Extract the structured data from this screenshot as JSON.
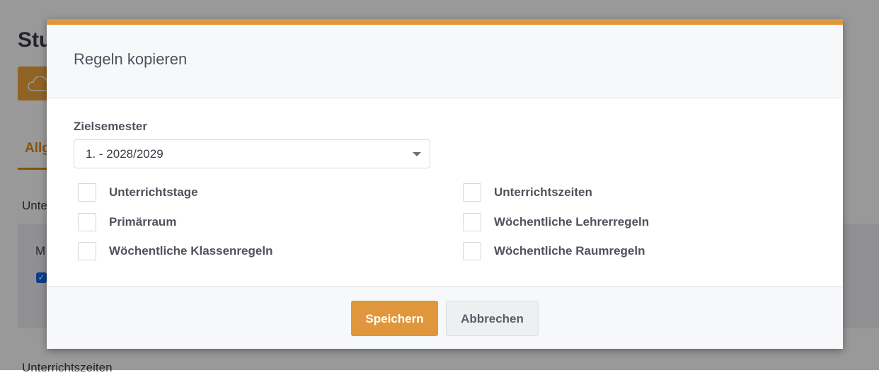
{
  "background": {
    "title": "Stu",
    "tab_label": "Allg",
    "section1": "Unte",
    "panel_label": "M",
    "section2": "Unterrichtszeiten"
  },
  "modal": {
    "title": "Regeln kopieren",
    "target_semester": {
      "label": "Zielsemester",
      "selected": "1. - 2028/2029"
    },
    "options": [
      {
        "label": "Unterrichtstage",
        "checked": false
      },
      {
        "label": "Unterrichtszeiten",
        "checked": false
      },
      {
        "label": "Primärraum",
        "checked": false
      },
      {
        "label": "Wöchentliche Lehrerregeln",
        "checked": false
      },
      {
        "label": "Wöchentliche Klassenregeln",
        "checked": false
      },
      {
        "label": "Wöchentliche Raumregeln",
        "checked": false
      }
    ],
    "save_label": "Speichern",
    "cancel_label": "Abbrechen"
  },
  "colors": {
    "accent": "#e0963a",
    "text": "#4f535c"
  }
}
